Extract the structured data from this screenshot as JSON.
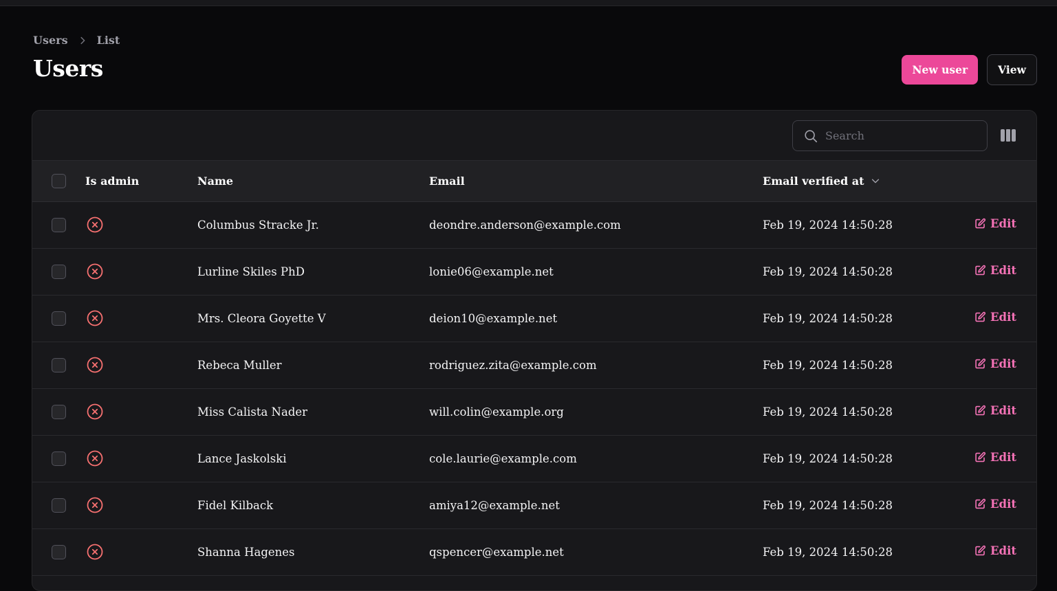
{
  "breadcrumb": {
    "items": [
      "Users",
      "List"
    ]
  },
  "page": {
    "title": "Users"
  },
  "header": {
    "new_user_label": "New user",
    "view_label": "View"
  },
  "search": {
    "placeholder": "Search",
    "value": ""
  },
  "table": {
    "columns": {
      "is_admin": "Is admin",
      "name": "Name",
      "email": "Email",
      "email_verified_at": "Email verified at"
    },
    "edit_label": "Edit",
    "rows": [
      {
        "is_admin": false,
        "name": "Columbus Stracke Jr.",
        "email": "deondre.anderson@example.com",
        "verified": "Feb 19, 2024 14:50:28"
      },
      {
        "is_admin": false,
        "name": "Lurline Skiles PhD",
        "email": "lonie06@example.net",
        "verified": "Feb 19, 2024 14:50:28"
      },
      {
        "is_admin": false,
        "name": "Mrs. Cleora Goyette V",
        "email": "deion10@example.net",
        "verified": "Feb 19, 2024 14:50:28"
      },
      {
        "is_admin": false,
        "name": "Rebeca Muller",
        "email": "rodriguez.zita@example.com",
        "verified": "Feb 19, 2024 14:50:28"
      },
      {
        "is_admin": false,
        "name": "Miss Calista Nader",
        "email": "will.colin@example.org",
        "verified": "Feb 19, 2024 14:50:28"
      },
      {
        "is_admin": false,
        "name": "Lance Jaskolski",
        "email": "cole.laurie@example.com",
        "verified": "Feb 19, 2024 14:50:28"
      },
      {
        "is_admin": false,
        "name": "Fidel Kilback",
        "email": "amiya12@example.net",
        "verified": "Feb 19, 2024 14:50:28"
      },
      {
        "is_admin": false,
        "name": "Shanna Hagenes",
        "email": "qspencer@example.net",
        "verified": "Feb 19, 2024 14:50:28"
      }
    ]
  },
  "colors": {
    "background": "#09090b",
    "panel": "#18181b",
    "accent": "#ec4899",
    "accent_text": "#f472b6",
    "danger_icon": "#f87171"
  },
  "icons": {
    "breadcrumb_separator": "chevron-right-icon",
    "search": "search-icon",
    "columns_toggle": "columns-icon",
    "sort": "chevron-down-icon",
    "not_admin": "x-circle-icon",
    "edit": "pencil-square-icon"
  }
}
